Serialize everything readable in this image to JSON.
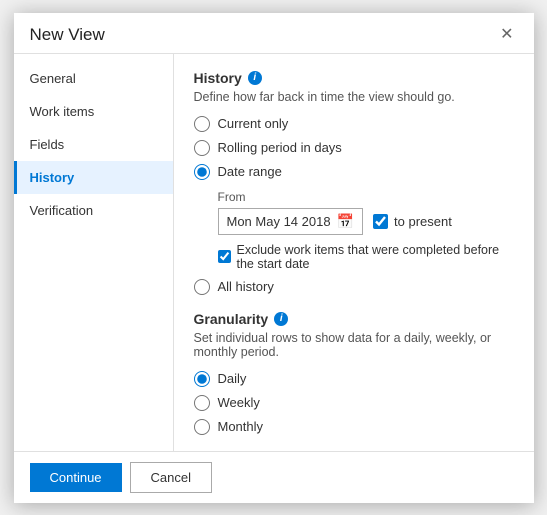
{
  "dialog": {
    "title": "New View",
    "close_label": "✕"
  },
  "sidebar": {
    "items": [
      {
        "id": "general",
        "label": "General",
        "active": false
      },
      {
        "id": "work-items",
        "label": "Work items",
        "active": false
      },
      {
        "id": "fields",
        "label": "Fields",
        "active": false
      },
      {
        "id": "history",
        "label": "History",
        "active": true
      },
      {
        "id": "verification",
        "label": "Verification",
        "active": false
      }
    ]
  },
  "content": {
    "section1": {
      "title": "History",
      "description": "Define how far back in time the view should go.",
      "options": [
        {
          "id": "current-only",
          "label": "Current only",
          "checked": false
        },
        {
          "id": "rolling-period",
          "label": "Rolling period in days",
          "checked": false
        },
        {
          "id": "date-range",
          "label": "Date range",
          "checked": true
        },
        {
          "id": "all-history",
          "label": "All history",
          "checked": false
        }
      ],
      "from_label": "From",
      "date_value": "Mon May 14 2018",
      "to_present_label": "to present",
      "to_present_checked": true,
      "exclude_label": "Exclude work items that were completed before the start date",
      "exclude_checked": true
    },
    "section2": {
      "title": "Granularity",
      "description": "Set individual rows to show data for a daily, weekly, or monthly period.",
      "options": [
        {
          "id": "daily",
          "label": "Daily",
          "checked": true
        },
        {
          "id": "weekly",
          "label": "Weekly",
          "checked": false
        },
        {
          "id": "monthly",
          "label": "Monthly",
          "checked": false
        }
      ]
    }
  },
  "footer": {
    "continue_label": "Continue",
    "cancel_label": "Cancel"
  }
}
